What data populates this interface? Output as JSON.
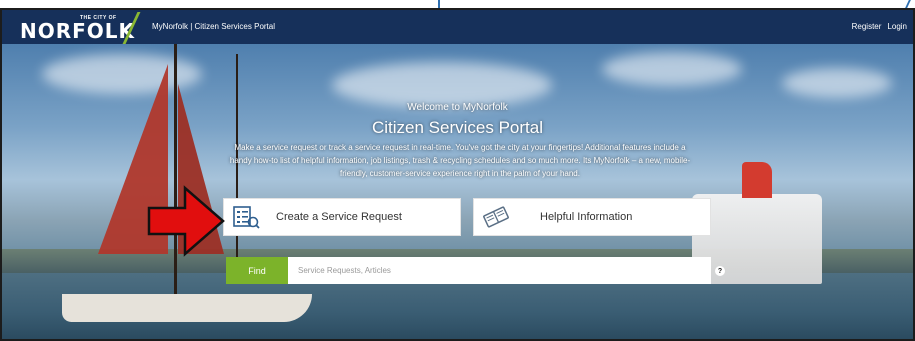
{
  "header": {
    "logo_tagline": "THE CITY OF",
    "logo_text": "NORFOLK",
    "portal_name": "MyNorfolk | Citizen Services Portal",
    "register_label": "Register",
    "login_label": "Login"
  },
  "hero": {
    "welcome": "Welcome to MyNorfolk",
    "title": "Citizen Services Portal",
    "description": "Make a service request or track a service request in real-time. You've got the city at your fingertips! Additional features include a handy how-to list of helpful information, job listings, trash & recycling schedules and so much more. Its MyNorfolk – a new, mobile-friendly, customer-service experience right in the palm of your hand."
  },
  "actions": {
    "service_request_label": "Create a Service Request",
    "helpful_info_label": "Helpful Information"
  },
  "search": {
    "find_label": "Find",
    "placeholder": "Service Requests, Articles",
    "help_glyph": "?"
  },
  "colors": {
    "header_bg": "#16305a",
    "accent_green": "#7cb32a",
    "arrow_red": "#e10e0e"
  }
}
